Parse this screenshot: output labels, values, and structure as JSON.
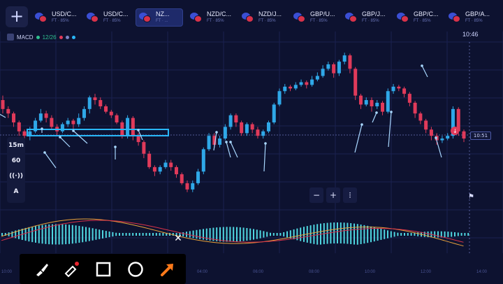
{
  "topbar": {
    "add_label": "+",
    "tabs": [
      {
        "name": "USD/C...",
        "sub": "FT · 85%",
        "active": false
      },
      {
        "name": "USD/C...",
        "sub": "FT · 85%",
        "active": false
      },
      {
        "name": "NZ...",
        "sub": "FT · ...",
        "active": true
      },
      {
        "name": "NZD/C...",
        "sub": "FT · 85%",
        "active": false
      },
      {
        "name": "NZD/J...",
        "sub": "FT · 85%",
        "active": false
      },
      {
        "name": "GBP/U...",
        "sub": "FT · 85%",
        "active": false
      },
      {
        "name": "GBP/J...",
        "sub": "FT · 85%",
        "active": false
      },
      {
        "name": "GBP/C...",
        "sub": "FT · 85%",
        "active": false
      },
      {
        "name": "GBP/A...",
        "sub": "FT · 85%",
        "active": false
      }
    ]
  },
  "indicator": {
    "name": "MACD",
    "params": "12/26"
  },
  "clock": "10:46",
  "sidebar": {
    "timeframe": "15m",
    "chart_type": "60",
    "signal": "((·))",
    "draw": "A"
  },
  "price_label": "10:51",
  "zoom": {
    "minus": "−",
    "plus": "+",
    "more": "⁝"
  },
  "close_label": "✕",
  "time_axis": [
    "10:00",
    "04:00",
    "06:00",
    "08:00",
    "10:00",
    "12:00",
    "14:00"
  ],
  "colors": {
    "up": "#2fa8e8",
    "down": "#e03a5a",
    "background": "#0d1230",
    "accent": "#ff7a1a",
    "highlight": "#29b6f6"
  },
  "chart_data": {
    "type": "candlestick",
    "candles": [
      [
        0.45,
        0.35,
        0.3,
        0.5
      ],
      [
        0.35,
        0.3,
        0.25,
        0.38
      ],
      [
        0.3,
        0.2,
        0.15,
        0.32
      ],
      [
        0.2,
        0.1,
        0.05,
        0.22
      ],
      [
        0.1,
        0.05,
        -0.02,
        0.12
      ],
      [
        0.05,
        0.1,
        0.0,
        0.15
      ],
      [
        0.1,
        0.22,
        0.08,
        0.25
      ],
      [
        0.22,
        0.3,
        0.2,
        0.35
      ],
      [
        0.3,
        0.25,
        0.2,
        0.33
      ],
      [
        0.25,
        0.15,
        0.12,
        0.28
      ],
      [
        0.15,
        0.1,
        0.05,
        0.18
      ],
      [
        0.1,
        0.18,
        0.08,
        0.2
      ],
      [
        0.18,
        0.22,
        0.15,
        0.25
      ],
      [
        0.22,
        0.18,
        0.1,
        0.24
      ],
      [
        0.18,
        0.25,
        0.15,
        0.3
      ],
      [
        0.25,
        0.35,
        0.22,
        0.38
      ],
      [
        0.35,
        0.48,
        0.3,
        0.5
      ],
      [
        0.48,
        0.45,
        0.4,
        0.52
      ],
      [
        0.45,
        0.38,
        0.35,
        0.48
      ],
      [
        0.38,
        0.32,
        0.3,
        0.4
      ],
      [
        0.32,
        0.28,
        0.25,
        0.34
      ],
      [
        0.28,
        0.2,
        0.18,
        0.3
      ],
      [
        0.2,
        0.05,
        0.02,
        0.22
      ],
      [
        0.05,
        0.25,
        0.02,
        0.28
      ],
      [
        0.25,
        0.05,
        0.0,
        0.27
      ],
      [
        0.05,
        -0.02,
        -0.06,
        0.08
      ],
      [
        -0.02,
        -0.15,
        -0.2,
        0.0
      ],
      [
        -0.15,
        -0.3,
        -0.32,
        -0.12
      ],
      [
        -0.3,
        -0.35,
        -0.4,
        -0.28
      ],
      [
        -0.35,
        -0.3,
        -0.38,
        -0.28
      ],
      [
        -0.3,
        -0.25,
        -0.32,
        -0.22
      ],
      [
        -0.25,
        -0.3,
        -0.34,
        -0.22
      ],
      [
        -0.3,
        -0.38,
        -0.42,
        -0.28
      ],
      [
        -0.38,
        -0.48,
        -0.5,
        -0.36
      ],
      [
        -0.48,
        -0.55,
        -0.58,
        -0.45
      ],
      [
        -0.55,
        -0.48,
        -0.58,
        -0.45
      ],
      [
        -0.48,
        -0.35,
        -0.5,
        -0.32
      ],
      [
        -0.35,
        -0.1,
        -0.38,
        -0.08
      ],
      [
        -0.1,
        0.05,
        -0.12,
        0.08
      ],
      [
        0.05,
        -0.05,
        -0.08,
        0.08
      ],
      [
        -0.05,
        0.02,
        -0.08,
        0.05
      ],
      [
        0.02,
        0.15,
        0.0,
        0.18
      ],
      [
        0.15,
        0.28,
        0.12,
        0.3
      ],
      [
        0.28,
        0.2,
        0.15,
        0.3
      ],
      [
        0.2,
        0.08,
        0.05,
        0.22
      ],
      [
        0.08,
        0.18,
        0.05,
        0.2
      ],
      [
        0.18,
        0.12,
        0.08,
        0.2
      ],
      [
        0.12,
        0.05,
        0.02,
        0.15
      ],
      [
        0.05,
        0.1,
        0.02,
        0.12
      ],
      [
        0.1,
        0.2,
        0.08,
        0.22
      ],
      [
        0.2,
        0.4,
        0.18,
        0.42
      ],
      [
        0.4,
        0.55,
        0.38,
        0.58
      ],
      [
        0.55,
        0.6,
        0.52,
        0.63
      ],
      [
        0.6,
        0.58,
        0.55,
        0.62
      ],
      [
        0.58,
        0.62,
        0.56,
        0.65
      ],
      [
        0.62,
        0.65,
        0.6,
        0.68
      ],
      [
        0.65,
        0.62,
        0.58,
        0.67
      ],
      [
        0.62,
        0.68,
        0.6,
        0.72
      ],
      [
        0.68,
        0.72,
        0.66,
        0.76
      ],
      [
        0.72,
        0.8,
        0.7,
        0.84
      ],
      [
        0.8,
        0.85,
        0.78,
        0.88
      ],
      [
        0.85,
        0.75,
        0.7,
        0.87
      ],
      [
        0.75,
        0.88,
        0.72,
        0.9
      ],
      [
        0.88,
        0.95,
        0.85,
        0.98
      ],
      [
        0.95,
        0.8,
        0.75,
        0.97
      ],
      [
        0.8,
        0.5,
        0.45,
        0.82
      ],
      [
        0.5,
        0.4,
        0.35,
        0.52
      ],
      [
        0.4,
        0.45,
        0.38,
        0.48
      ],
      [
        0.45,
        0.38,
        0.32,
        0.48
      ],
      [
        0.38,
        0.42,
        0.35,
        0.45
      ],
      [
        0.42,
        0.32,
        0.28,
        0.44
      ],
      [
        0.32,
        0.55,
        0.3,
        0.58
      ],
      [
        0.55,
        0.6,
        0.52,
        0.63
      ],
      [
        0.6,
        0.58,
        0.55,
        0.62
      ],
      [
        0.58,
        0.52,
        0.48,
        0.6
      ],
      [
        0.52,
        0.42,
        0.38,
        0.54
      ],
      [
        0.42,
        0.3,
        0.25,
        0.44
      ],
      [
        0.3,
        0.22,
        0.18,
        0.32
      ],
      [
        0.22,
        0.12,
        0.08,
        0.24
      ],
      [
        0.12,
        0.05,
        0.0,
        0.15
      ],
      [
        0.05,
        0.0,
        -0.05,
        0.08
      ],
      [
        0.0,
        0.02,
        -0.03,
        0.05
      ],
      [
        0.02,
        0.05,
        0.0,
        0.08
      ],
      [
        0.05,
        0.35,
        0.02,
        0.38
      ],
      [
        0.35,
        0.1,
        0.05,
        0.37
      ],
      [
        0.1,
        0.02,
        -0.02,
        0.12
      ]
    ]
  }
}
